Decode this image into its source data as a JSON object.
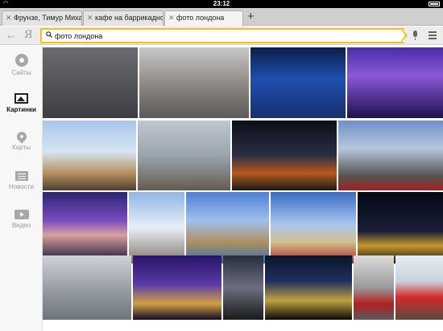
{
  "status_bar": {
    "time": "23:12"
  },
  "tabs": [
    {
      "label": "Фрунзе, Тимур Михай",
      "active": false
    },
    {
      "label": "кафе на баррикадной",
      "active": false
    },
    {
      "label": "фото лондона",
      "active": true
    }
  ],
  "new_tab_symbol": "+",
  "address_bar": {
    "logo": "Я",
    "query": "фото лондона",
    "accent_color": "#f3c21a"
  },
  "sidebar": {
    "items": [
      {
        "label": "Сайты",
        "icon": "sites-icon",
        "active": false
      },
      {
        "label": "Картинки",
        "icon": "pictures-icon",
        "active": true
      },
      {
        "label": "Карты",
        "icon": "map-pin-icon",
        "active": false
      },
      {
        "label": "Новости",
        "icon": "news-icon",
        "active": false
      },
      {
        "label": "Видео",
        "icon": "video-icon",
        "active": false
      }
    ]
  },
  "results": {
    "images": [
      {
        "subject": "foggy-lamppost-night"
      },
      {
        "subject": "aerial-city-dome"
      },
      {
        "subject": "tower-bridge-night-blue"
      },
      {
        "subject": "parliament-twilight-purple"
      },
      {
        "subject": "big-ben-daylight"
      },
      {
        "subject": "tower-bridge-river-day"
      },
      {
        "subject": "trafalgar-fountain-night"
      },
      {
        "subject": "parliament-street-bus"
      },
      {
        "subject": "tower-bridge-purple-sky"
      },
      {
        "subject": "nelson-column-sky"
      },
      {
        "subject": "parliament-river-blue"
      },
      {
        "subject": "big-ben-bus-sky"
      },
      {
        "subject": "tower-bridge-night-lights"
      },
      {
        "subject": "thames-aerial-fog"
      },
      {
        "subject": "parliament-dusk-lights"
      },
      {
        "subject": "big-ben-street-taxi"
      },
      {
        "subject": "palace-night-lights"
      },
      {
        "subject": "phone-boxes-street"
      },
      {
        "subject": "red-double-decker-bus"
      }
    ]
  }
}
